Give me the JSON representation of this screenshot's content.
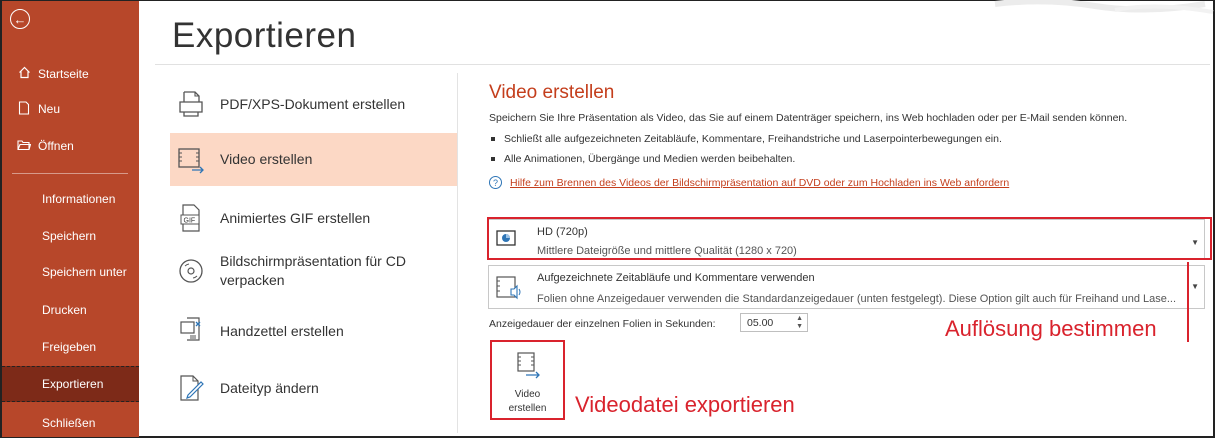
{
  "sidebar": {
    "back_icon": "back-arrow-icon",
    "nav": [
      {
        "label": "Startseite",
        "icon": "home-icon"
      },
      {
        "label": "Neu",
        "icon": "new-document-icon"
      },
      {
        "label": "Öffnen",
        "icon": "folder-open-icon"
      }
    ],
    "items": [
      {
        "label": "Informationen"
      },
      {
        "label": "Speichern"
      },
      {
        "label": "Speichern unter"
      },
      {
        "label": "Drucken"
      },
      {
        "label": "Freigeben"
      },
      {
        "label": "Exportieren",
        "active": true
      },
      {
        "label": "Schließen"
      }
    ],
    "color": "#b7472a",
    "active_color": "#7d2a18"
  },
  "page": {
    "title": "Exportieren"
  },
  "options": [
    {
      "label": "PDF/XPS-Dokument erstellen",
      "icon": "pdf-document-icon"
    },
    {
      "label": "Video erstellen",
      "icon": "video-film-icon",
      "selected": true
    },
    {
      "label": "Animiertes GIF erstellen",
      "icon": "gif-file-icon"
    },
    {
      "label": "Bildschirmpräsentation für CD",
      "label2": "verpacken",
      "icon": "cd-disc-icon"
    },
    {
      "label": "Handzettel erstellen",
      "icon": "handout-icon"
    },
    {
      "label": "Dateityp ändern",
      "icon": "change-file-type-icon"
    }
  ],
  "pane": {
    "title": "Video erstellen",
    "description": "Speichern Sie Ihre Präsentation als Video, das Sie auf einem Datenträger speichern, ins Web hochladen oder per E-Mail senden können.",
    "bullets": [
      "Schließt alle aufgezeichneten Zeitabläufe, Kommentare, Freihandstriche und Laserpointerbewegungen ein.",
      "Alle Animationen, Übergänge und Medien werden beibehalten."
    ],
    "help_link": "Hilfe zum Brennen des Videos der Bildschirmpräsentation auf DVD oder zum Hochladen ins Web anfordern",
    "quality": {
      "title": "HD (720p)",
      "subtitle": "Mittlere Dateigröße und mittlere Qualität (1280 x 720)",
      "icon": "monitor-quality-icon"
    },
    "timing": {
      "title": "Aufgezeichnete Zeitabläufe und Kommentare verwenden",
      "subtitle": "Folien ohne Anzeigedauer verwenden die Standardanzeigedauer (unten festgelegt). Diese Option gilt auch für Freihand und Lase...",
      "icon": "recorded-timing-icon"
    },
    "duration_label": "Anzeigedauer der einzelnen Folien in Sekunden:",
    "duration_value": "05.00",
    "create_button": {
      "line1": "Video",
      "line2": "erstellen"
    }
  },
  "annotations": {
    "resolution": "Auflösung bestimmen",
    "export": "Videodatei exportieren",
    "color": "#d9232d"
  },
  "accent": "#c43e1c"
}
